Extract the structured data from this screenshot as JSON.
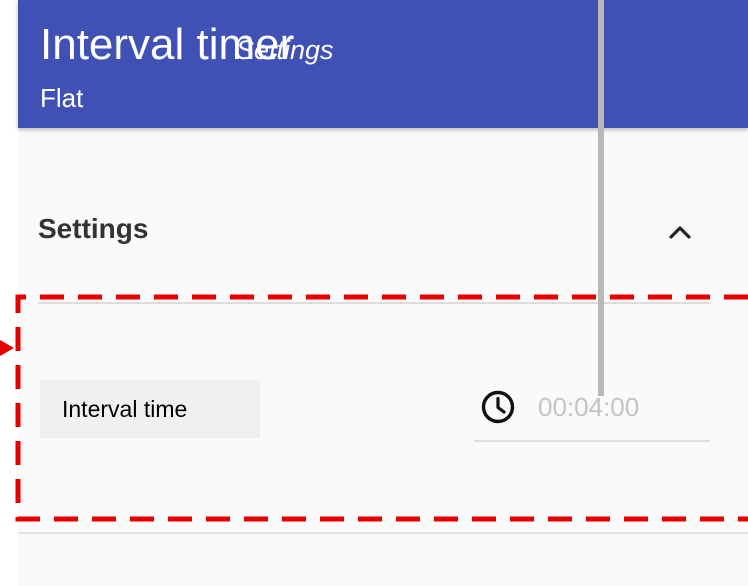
{
  "app_bar": {
    "title": "Interval timer",
    "subtitle": "Settings",
    "caption": "Flat"
  },
  "settings": {
    "section_title": "Settings",
    "collapse_icon": "chevron-up-icon",
    "fields": [
      {
        "label": "Interval time",
        "icon": "clock-icon",
        "value": "00:04:00"
      }
    ]
  },
  "colors": {
    "app_bar": "#3f51b5",
    "highlight_dashes": "#e60000",
    "pointer_line": "#b8b8b8"
  }
}
